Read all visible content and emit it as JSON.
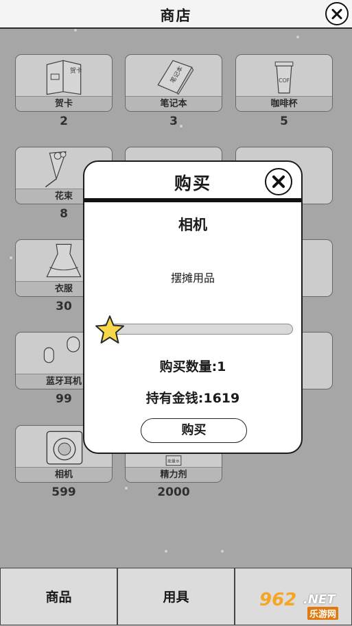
{
  "header": {
    "title": "商店"
  },
  "shop": {
    "items": [
      {
        "name": "贺卡",
        "price": "2",
        "icon": "greeting-card-icon"
      },
      {
        "name": "笔记本",
        "price": "3",
        "icon": "notebook-icon"
      },
      {
        "name": "咖啡杯",
        "price": "5",
        "icon": "coffee-cup-icon"
      },
      {
        "name": "花束",
        "price": "8",
        "icon": "bouquet-icon"
      },
      {
        "name": "衣服",
        "price": "30",
        "icon": "dress-icon"
      },
      {
        "name": "蓝牙耳机",
        "price": "99",
        "icon": "earbuds-icon"
      },
      {
        "name": "相机",
        "price": "599",
        "icon": "camera-icon"
      },
      {
        "name": "精力剂",
        "price": "2000",
        "icon": "energy-drink-icon"
      }
    ],
    "card_art_text": {
      "greeting_card": "贺卡",
      "notebook": "笔记本",
      "cup": "COF",
      "energy_label": "能量水"
    }
  },
  "dialog": {
    "title": "购买",
    "item_name": "相机",
    "description": "摆摊用品",
    "quantity_text": "购买数量:1",
    "money_text": "持有金钱:1619",
    "buy_button": "购买",
    "quantity_slider": {
      "min": 1,
      "value": 1
    }
  },
  "tabs": [
    {
      "label": "商品"
    },
    {
      "label": "用具"
    },
    {
      "label": ""
    }
  ],
  "watermark": {
    "number": "962",
    "net": ".NET",
    "cn": "乐游网"
  },
  "colors": {
    "background": "#bfbfbf",
    "card": "#f2f2f2",
    "label_band": "#d6d6d6",
    "star": "#f7d84b",
    "watermark": "#f5a623"
  }
}
